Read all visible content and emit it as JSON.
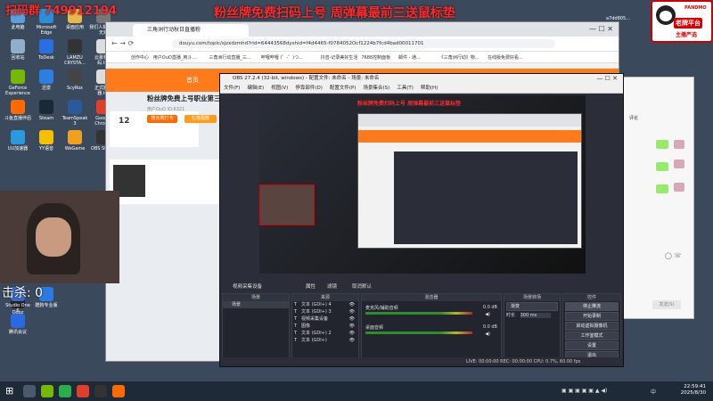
{
  "overlay": {
    "qq_label": "扫码群",
    "qq_number": "749912194",
    "headline": "粉丝牌免费扫码上号   周弹幕最前三送鼠标垫",
    "logo_brand": "PANDMO",
    "logo_badge": "老牌平台",
    "logo_sub": "主播严选",
    "top_right_text": "a7dd805..."
  },
  "desktop_icons": [
    {
      "label": "此电脑",
      "color": "#5aa0e0"
    },
    {
      "label": "Microsoft Edge",
      "color": "#2a8fd6"
    },
    {
      "label": "桌面应用",
      "color": "#e8b84a"
    },
    {
      "label": "我们人机 我们无双",
      "color": "#777777"
    },
    {
      "label": "回收站",
      "color": "#8fb0c8"
    },
    {
      "label": "ToDesk",
      "color": "#2a6fe0"
    },
    {
      "label": "LAMZU CRYSTA...",
      "color": "#333333"
    },
    {
      "label": "云慕我的码.txt",
      "color": "#dddddd"
    },
    {
      "label": "GeForce Experience",
      "color": "#76b900"
    },
    {
      "label": "迅雷",
      "color": "#2a7fe0"
    },
    {
      "label": "ScyRox",
      "color": "#444444"
    },
    {
      "label": "正式服务器.txt",
      "color": "#dddddd"
    },
    {
      "label": "斗鱼直播伴侣",
      "color": "#ff6a00"
    },
    {
      "label": "Steam",
      "color": "#1b2838"
    },
    {
      "label": "TeamSpeak 3",
      "color": "#2a5a9a"
    },
    {
      "label": "Google Chrome",
      "color": "#e0402a"
    },
    {
      "label": "UU加速器",
      "color": "#2a9ae0"
    },
    {
      "label": "YY语音",
      "color": "#f5c000"
    },
    {
      "label": "WeGame",
      "color": "#f0a020"
    },
    {
      "label": "OBS Studio",
      "color": "#333333"
    },
    {
      "label": "Oopz",
      "color": "#222222"
    },
    {
      "label": "Studio One 6",
      "color": "#3a6ad0"
    },
    {
      "label": "酷狗专业版",
      "color": "#2a7ae0"
    },
    {
      "label": "腾讯会议",
      "color": "#2a6ae0"
    }
  ],
  "browser": {
    "tab_title": "三角洲行动秋日直播粉",
    "url": "douyu.com/topic/sjzxdzmhd?rid=64443568dyshid=f4d4465-f0784052Ocf1224b7fcd4bad00011701",
    "bookmarks": [
      "创作中心",
      "用户OuO直播_用斗...",
      "三角洲行动直播_三...",
      "哔哩哔哩 (゜-゜)つ...",
      "抖音-记录美好生活",
      "7688控制面板",
      "邮件 - 通...",
      "《三角洲行动》物...",
      "在线版免费好看..."
    ],
    "nav_home": "首页",
    "room_num": "12",
    "room_title": "粉丝牌免费上号职业第三",
    "room_stats": "用户OuO  ID:6321",
    "follow_label": "粉丝牌打卡",
    "gift_label": "礼物捐赠"
  },
  "chat": {
    "title": "评论",
    "send_label": "发送(S)"
  },
  "obs": {
    "title": "OBS 27.2.4 (32-bit, windows) - 配置文件: 未命名 - 场景: 未命名",
    "menu": [
      "文件(F)",
      "编辑(E)",
      "视图(V)",
      "停靠部件(D)",
      "配置文件(P)",
      "场景集合(S)",
      "工具(T)",
      "帮助(H)"
    ],
    "preview_headline": "粉丝牌免费扫码上号   周弹幕最前三送鼠标垫",
    "panel_tabs": [
      "视频采集设备",
      "属性",
      "滤镜",
      "取消默认"
    ],
    "scenes_header": "场景",
    "scenes": [
      "场景"
    ],
    "sources_header": "来源",
    "sources": [
      "文本 (GDI+) 4",
      "文本 (GDI+) 3",
      "视频采集设备",
      "图像",
      "文本 (GDI+) 2",
      "文本 (GDI+)"
    ],
    "mixer_header": "混音器",
    "mixer": [
      {
        "name": "麦克风/辅助音频",
        "db": "0.0 dB"
      },
      {
        "name": "桌面音频",
        "db": "0.0 dB"
      }
    ],
    "transition_header": "场景转场",
    "transition_type": "渐变",
    "duration_label": "时长",
    "duration_value": "300 ms",
    "controls_header": "控件",
    "controls": [
      "停止推流",
      "开始录制",
      "启动虚拟摄像机",
      "工作室模式",
      "设置",
      "退出"
    ],
    "status": "LIVE: 00:00:00   REC: 00:00:00   CPU: 0.7%, 60.00 fps"
  },
  "overlay_kill": "击杀: 0",
  "taskbar": {
    "time": "22:59:41",
    "date": "2025/8/30",
    "tray_text": "中"
  }
}
